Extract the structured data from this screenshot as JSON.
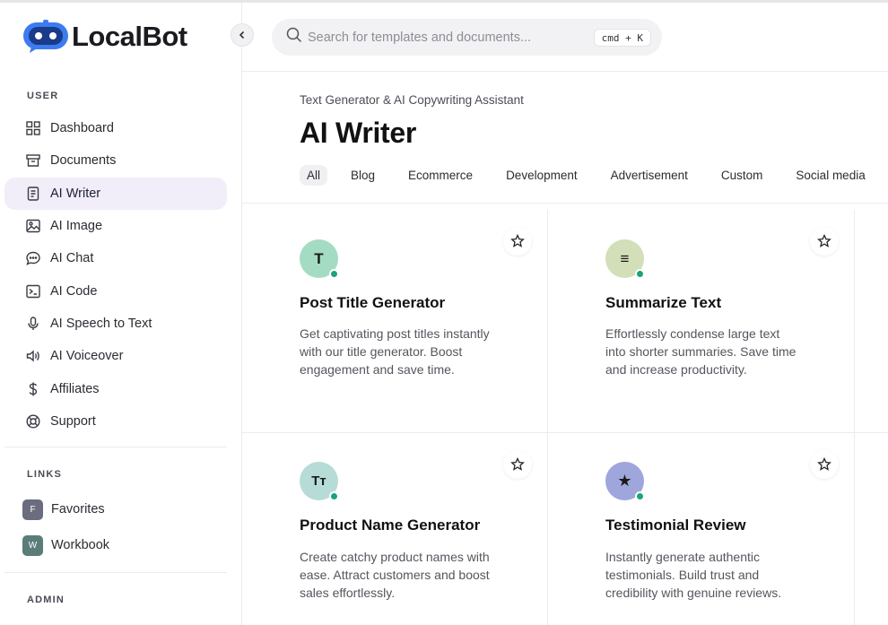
{
  "app": {
    "name": "LocalBot"
  },
  "search": {
    "placeholder": "Search for templates and documents...",
    "shortcut": "cmd + K"
  },
  "sidebar": {
    "user_label": "USER",
    "items": [
      {
        "label": "Dashboard",
        "icon": "dashboard-icon",
        "active": false
      },
      {
        "label": "Documents",
        "icon": "archive-icon",
        "active": false
      },
      {
        "label": "AI Writer",
        "icon": "document-icon",
        "active": true
      },
      {
        "label": "AI Image",
        "icon": "image-icon",
        "active": false
      },
      {
        "label": "AI Chat",
        "icon": "chat-icon",
        "active": false
      },
      {
        "label": "AI Code",
        "icon": "terminal-icon",
        "active": false
      },
      {
        "label": "AI Speech to Text",
        "icon": "microphone-icon",
        "active": false
      },
      {
        "label": "AI Voiceover",
        "icon": "speaker-icon",
        "active": false
      },
      {
        "label": "Affiliates",
        "icon": "dollar-icon",
        "active": false
      },
      {
        "label": "Support",
        "icon": "lifebuoy-icon",
        "active": false
      }
    ],
    "links_label": "LINKS",
    "links": [
      {
        "label": "Favorites",
        "badge": "F",
        "color": "#6b6d7e"
      },
      {
        "label": "Workbook",
        "badge": "W",
        "color": "#5b7d7a"
      }
    ],
    "admin_label": "ADMIN"
  },
  "main": {
    "subtitle": "Text Generator & AI Copywriting Assistant",
    "title": "AI Writer",
    "tabs": [
      "All",
      "Blog",
      "Ecommerce",
      "Development",
      "Advertisement",
      "Custom",
      "Social media"
    ],
    "cards": [
      {
        "title": "Post Title Generator",
        "description": "Get captivating post titles instantly with our title generator. Boost engagement and save time.",
        "avatar": "T",
        "avatar_color": "#a4dcc3",
        "icon": "letter-t-icon"
      },
      {
        "title": "Summarize Text",
        "description": "Effortlessly condense large text into shorter summaries. Save time and increase productivity.",
        "avatar": "≡",
        "avatar_color": "#d2dfb8",
        "icon": "lines-icon"
      },
      {
        "title": "Product Name Generator",
        "description": "Create catchy product names with ease. Attract customers and boost sales effortlessly.",
        "avatar": "Tт",
        "avatar_color": "#b7dcd7",
        "icon": "text-size-icon"
      },
      {
        "title": "Testimonial Review",
        "description": "Instantly generate authentic testimonials. Build trust and credibility with genuine reviews.",
        "avatar": "★",
        "avatar_color": "#9ea6db",
        "icon": "star-filled-icon"
      }
    ]
  }
}
